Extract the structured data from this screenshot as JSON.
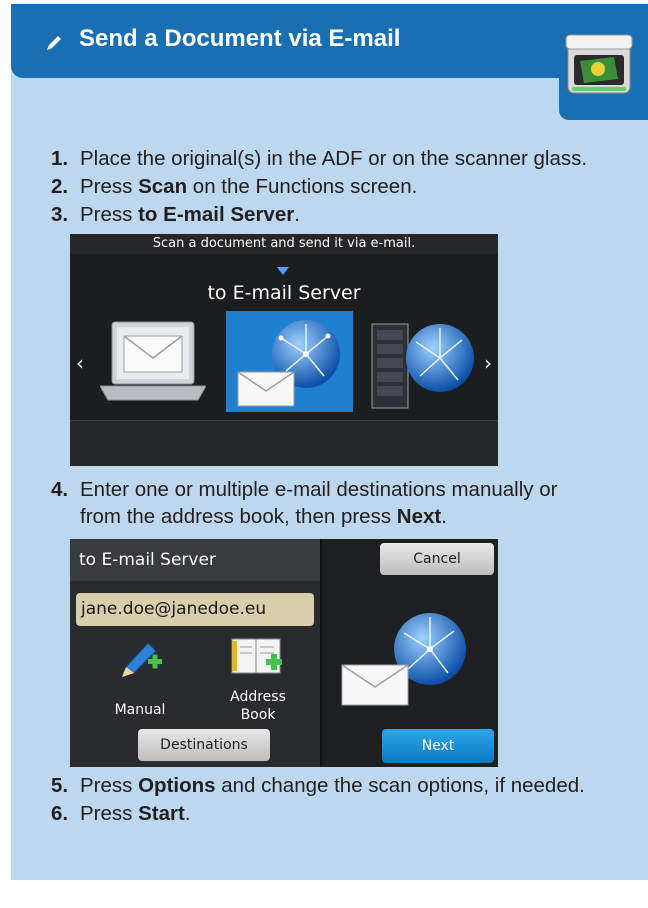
{
  "header": {
    "title": "Send a Document via E-mail",
    "pencil_icon": "pencil-icon",
    "scanner_icon": "scanner-icon"
  },
  "steps": [
    {
      "num": "1.",
      "pre": "Place the original(s) in the ADF or on the scanner glass.",
      "bold": "",
      "post": ""
    },
    {
      "num": "2.",
      "pre": "Press ",
      "bold": "Scan",
      "post": " on the Functions screen."
    },
    {
      "num": "3.",
      "pre": "Press ",
      "bold": "to E-mail Server",
      "post": "."
    },
    {
      "num": "4.",
      "pre": "Enter one or multiple e-mail destinations manually or",
      "bold": "",
      "post": ""
    },
    {
      "num": "5.",
      "pre": "Press ",
      "bold": "Options",
      "post": " and change the scan options, if needed."
    },
    {
      "num": "6.",
      "pre": "Press ",
      "bold": "Start",
      "post": "."
    }
  ],
  "step4_cont": {
    "pre": "from the address book, then press ",
    "bold": "Next",
    "post": "."
  },
  "screen1": {
    "hint": "Scan a document and send it via e-mail.",
    "selected_label": "to E-mail Server",
    "prev": "‹",
    "next": "›"
  },
  "screen2": {
    "title": "to E-mail Server",
    "email_value": "jane.doe@janedoe.eu",
    "manual_label": "Manual",
    "address_book_label_1": "Address",
    "address_book_label_2": "Book",
    "destinations_label": "Destinations",
    "cancel_label": "Cancel",
    "next_label": "Next"
  },
  "colors": {
    "header_blue": "#1a6fb3",
    "panel_bg": "#bcd7ee",
    "selection_blue": "#1f7fd0",
    "next_button": "#1a8fd6"
  }
}
